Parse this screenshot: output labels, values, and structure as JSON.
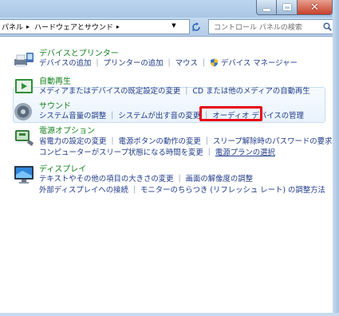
{
  "window": {
    "buttons": [
      "minimize",
      "maximize",
      "close"
    ]
  },
  "address_bar": {
    "crumbs": [
      "パネル",
      "ハードウェアとサウンド"
    ],
    "search_placeholder": "コントロール パネルの検索"
  },
  "categories": [
    {
      "title": "デバイスとプリンター",
      "icon": "printer-devices-icon",
      "lines": [
        [
          "デバイスの追加",
          "プリンターの追加",
          "マウス",
          "デバイス マネージャー"
        ]
      ]
    },
    {
      "title": "自動再生",
      "icon": "autoplay-icon",
      "lines": [
        [
          "メディアまたはデバイスの既定設定の変更",
          "CD または他のメディアの自動再生"
        ]
      ]
    },
    {
      "title": "サウンド",
      "icon": "speaker-icon",
      "lines": [
        [
          "システム音量の調整",
          "システムが出す音の変更",
          "オーディオ デバイスの管理"
        ]
      ]
    },
    {
      "title": "電源オプション",
      "icon": "power-options-icon",
      "lines": [
        [
          "省電力の設定の変更",
          "電源ボタンの動作の変更",
          "スリープ解除時のパスワードの要求"
        ],
        [
          "コンピューターがスリープ状態になる時間を変更",
          "電源プランの選択"
        ]
      ]
    },
    {
      "title": "ディスプレイ",
      "icon": "display-icon",
      "lines": [
        [
          "テキストやその他の項目の大きさの変更",
          "画面の解像度の調整"
        ],
        [
          "外部ディスプレイへの接続",
          "モニターのちらつき (リフレッシュ レート) の調整方法"
        ]
      ]
    }
  ],
  "colors": {
    "category_title": "#14811e",
    "link": "#1f3a8a",
    "highlight_box": "#e60012"
  }
}
